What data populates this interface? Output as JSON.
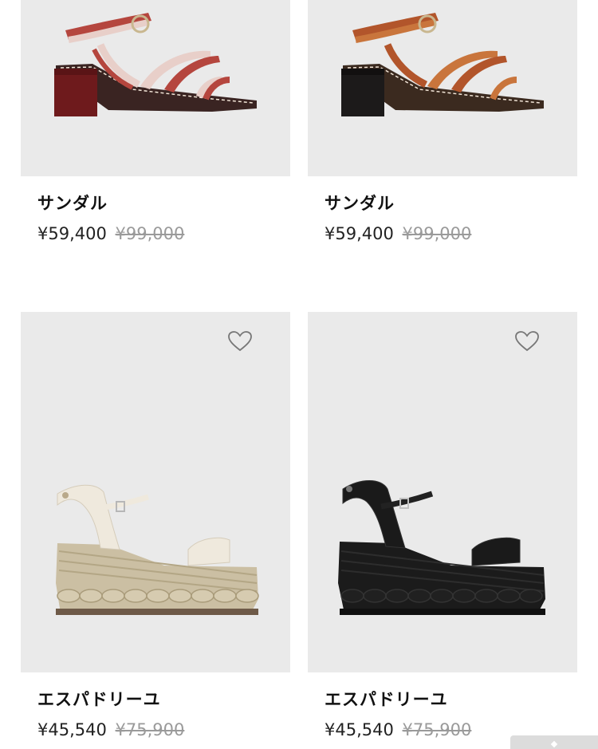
{
  "products": [
    {
      "name": "サンダル",
      "sale_price": "¥59,400",
      "original_price": "¥99,000",
      "image_icon": "red-block-heel-sandal-image",
      "colors": {
        "strap_a": "#b5463e",
        "strap_b": "#e8cfc9",
        "heel": "#6e1a1c",
        "sole": "#3a2422"
      }
    },
    {
      "name": "サンダル",
      "sale_price": "¥59,400",
      "original_price": "¥99,000",
      "image_icon": "brown-block-heel-sandal-image",
      "colors": {
        "strap_a": "#b2552b",
        "strap_b": "#c9753c",
        "heel": "#1c1a1a",
        "sole": "#3b2a1f"
      }
    },
    {
      "name": "エスパドリーユ",
      "sale_price": "¥45,540",
      "original_price": "¥75,900",
      "image_icon": "cream-espadrille-wedge-image",
      "colors": {
        "strap_a": "#efe9dd",
        "strap_b": "#e6ddcc",
        "heel": "#cbbfa3",
        "sole": "#6e5a48"
      },
      "wishlist_icon": "heart-outline-icon"
    },
    {
      "name": "エスパドリーユ",
      "sale_price": "¥45,540",
      "original_price": "¥75,900",
      "image_icon": "black-espadrille-wedge-image",
      "colors": {
        "strap_a": "#1a1a1a",
        "strap_b": "#222222",
        "heel": "#1b1b1b",
        "sole": "#111111"
      },
      "wishlist_icon": "heart-outline-icon"
    }
  ],
  "theme": {
    "image_bg": "#eaeaea",
    "text": "#111111",
    "muted": "#9a9a9a"
  }
}
